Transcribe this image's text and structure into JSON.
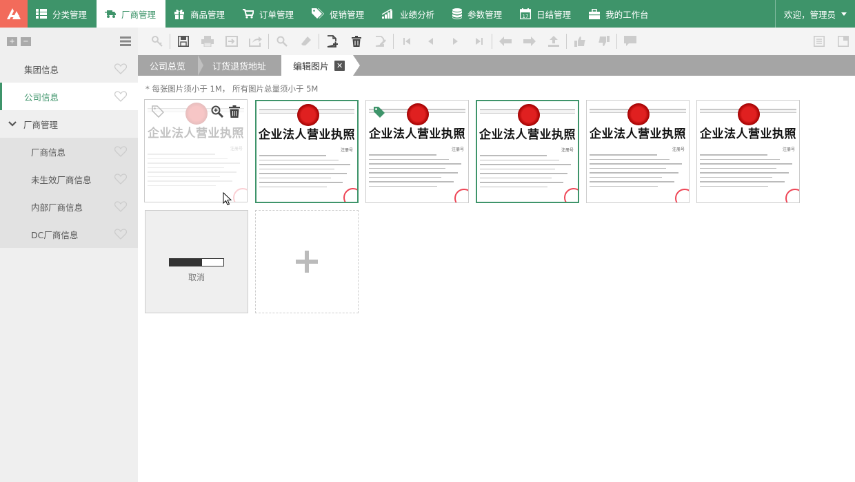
{
  "nav": {
    "items": [
      {
        "label": "分类管理",
        "icon": "list-icon"
      },
      {
        "label": "厂商管理",
        "icon": "truck-icon"
      },
      {
        "label": "商品管理",
        "icon": "gift-icon"
      },
      {
        "label": "订单管理",
        "icon": "cart-icon"
      },
      {
        "label": "促销管理",
        "icon": "tags-icon"
      },
      {
        "label": "业绩分析",
        "icon": "signal-icon"
      },
      {
        "label": "参数管理",
        "icon": "database-icon"
      },
      {
        "label": "日结管理",
        "icon": "calendar-icon"
      },
      {
        "label": "我的工作台",
        "icon": "briefcase-icon"
      }
    ],
    "active_index": 1,
    "user_label": "欢迎，管理员"
  },
  "sidebar": {
    "items": [
      {
        "label": "集团信息"
      },
      {
        "label": "公司信息"
      },
      {
        "label": "厂商管理"
      },
      {
        "label": "厂商信息"
      },
      {
        "label": "未生效厂商信息"
      },
      {
        "label": "内部厂商信息"
      },
      {
        "label": "DC厂商信息"
      }
    ],
    "active_index": 1
  },
  "tabs": [
    {
      "label": "公司总览"
    },
    {
      "label": "订货退货地址"
    },
    {
      "label": "编辑图片"
    }
  ],
  "content": {
    "note": "* 每张图片须小于 1M， 所有图片总量须小于 5M",
    "license_title": "企业法人营业执照",
    "license_reg": "注册号",
    "upload": {
      "progress": 0.6,
      "cancel_label": "取消"
    }
  },
  "colors": {
    "brand": "#3e946a",
    "logo": "#f26b5b",
    "tabbar": "#a5a5a5"
  }
}
